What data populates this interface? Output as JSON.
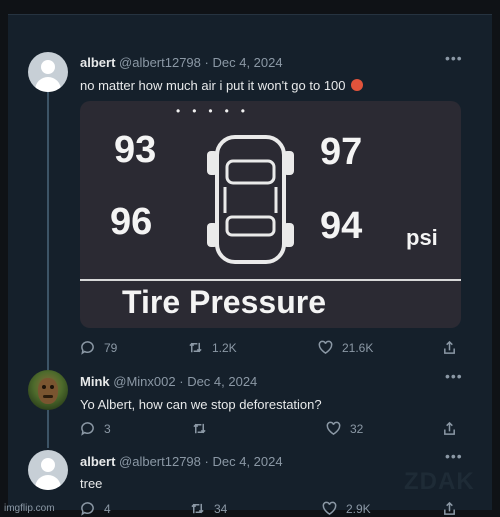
{
  "tweets": [
    {
      "name": "albert",
      "handle": "@albert12798",
      "sep": "·",
      "date": "Dec 4, 2024",
      "text": "no matter how much air i put it won't go to 100",
      "emoji_icon": "angry-face-emoji",
      "replies": "79",
      "retweets": "1.2K",
      "likes": "21.6K"
    },
    {
      "name": "Mink",
      "handle": "@Minx002",
      "sep": "·",
      "date": "Dec 4, 2024",
      "text": "Yo Albert, how can we stop deforestation?",
      "replies": "3",
      "retweets": "",
      "likes": "32"
    },
    {
      "name": "albert",
      "handle": "@albert12798",
      "sep": "·",
      "date": "Dec 4, 2024",
      "text": "tree",
      "replies": "4",
      "retweets": "34",
      "likes": "2.9K"
    }
  ],
  "photo": {
    "front_left": "93",
    "front_right": "97",
    "rear_left": "96",
    "rear_right": "94",
    "unit": "psi",
    "label": "Tire Pressure",
    "dots": "•••••"
  },
  "more_icon": "•••",
  "watermark": "ZDAK",
  "imgflip": "imgflip.com"
}
